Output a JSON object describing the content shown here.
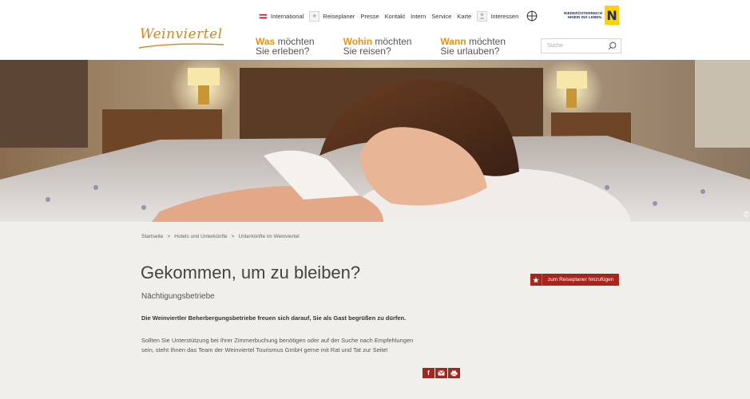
{
  "utility_nav": {
    "international": "International",
    "reiseplaner": "Reiseplaner",
    "presse": "Presse",
    "kontakt": "Kontakt",
    "intern": "Intern",
    "service": "Service",
    "karte": "Karte",
    "interessen": "Interessen"
  },
  "noe_logo": {
    "line1": "NIEDERÖSTERREICH",
    "line2": "HINEIN INS LEBEN.",
    "letter": "N"
  },
  "brand": "Weinviertel",
  "main_nav": [
    {
      "strong": "Was",
      "rest": "möchten",
      "line2": "Sie erleben?"
    },
    {
      "strong": "Wohin",
      "rest": "möchten",
      "line2": "Sie reisen?"
    },
    {
      "strong": "Wann",
      "rest": "möchten",
      "line2": "Sie urlauben?"
    }
  ],
  "search": {
    "placeholder": "Suche"
  },
  "hero": {
    "copyright": "©"
  },
  "breadcrumb": {
    "items": [
      "Startseite",
      "Hotels und Unterkünfte",
      "Unterkünfte im Weinviertel"
    ],
    "separator": ">"
  },
  "content": {
    "title": "Gekommen, um zu bleiben?",
    "subtitle": "Nächtigungsbetriebe",
    "lead": "Die Weinviertler Beherbergungsbetriebe freuen sich darauf, Sie als Gast begrüßen zu dürfen.",
    "body_line1": "Sollten Sie Unterstützung bei Ihrer Zimmerbuchung benötigen oder auf der Suche nach Empfehlungen",
    "body_line2": "sein, steht Ihnen das Team der Weinviertel Tourismus GmbH gerne mit Rat und Tat zur Seite!"
  },
  "planner_button": {
    "label": "zum Reiseplaner hinzufügen"
  },
  "share": {
    "facebook": "f"
  },
  "colors": {
    "accent": "#e39314",
    "brand": "#d2861b",
    "action": "#a8251d",
    "background": "#f1efe9"
  }
}
